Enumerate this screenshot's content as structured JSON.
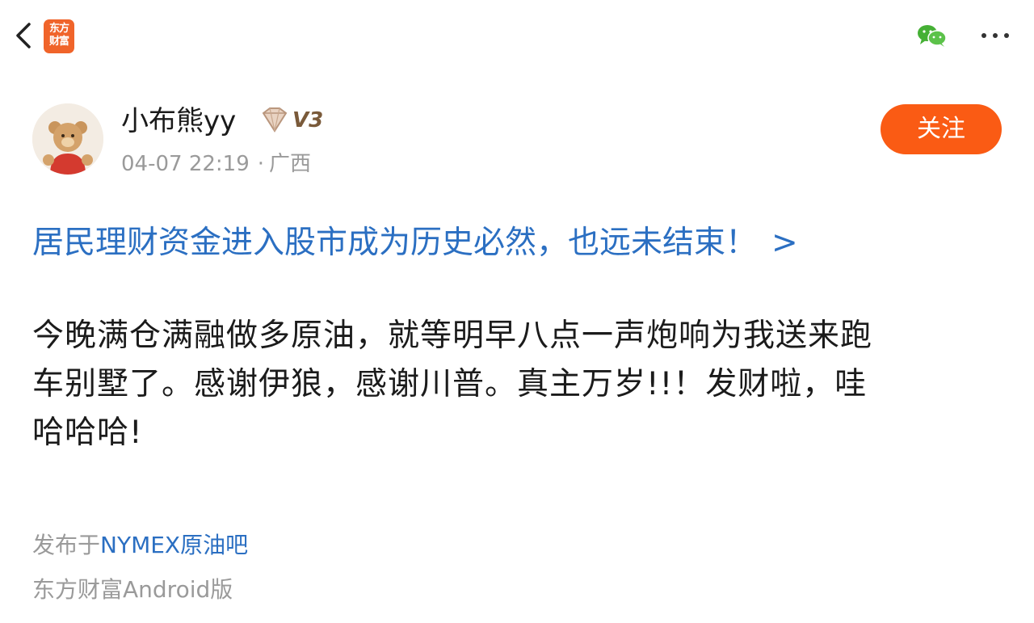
{
  "topbar": {
    "app_logo_line1": "东方",
    "app_logo_line2": "财富",
    "back_icon": "chevron-left-icon",
    "share_icon": "wechat-icon",
    "more_icon": "more-dots-icon"
  },
  "author": {
    "name": "小布熊yy",
    "badge_label": "V3",
    "timestamp": "04-07 22:19",
    "separator": "·",
    "location": "广西",
    "follow_label": "关注"
  },
  "post": {
    "title": "居民理财资金进入股市成为历史必然，也远未结束！",
    "title_arrow": ">",
    "body_lines": [
      "今晚满仓满融做多原油，就等明早八点一声炮响为我送来跑",
      "车别墅了。感谢伊狼，感谢川普。真主万岁!!！发财啦，哇",
      "哈哈哈!"
    ]
  },
  "footer": {
    "published_prefix": "发布于",
    "forum_name": "NYMEX原油吧",
    "client": "东方财富Android版"
  },
  "colors": {
    "accent_orange": "#fa5b14",
    "link_blue": "#2b6fc2",
    "muted_gray": "#9a9a9a"
  }
}
